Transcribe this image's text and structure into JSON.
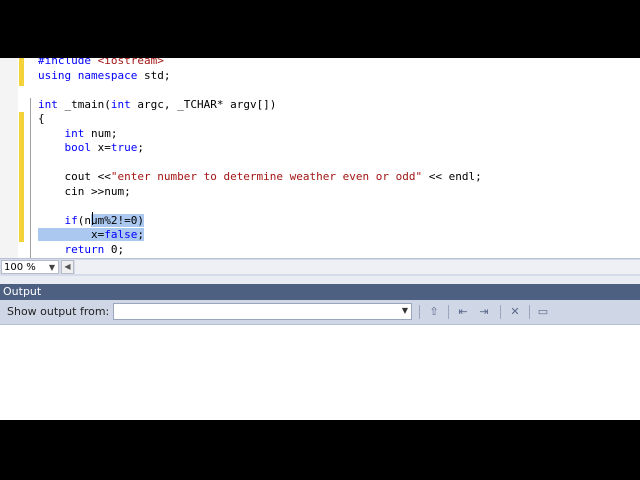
{
  "editor": {
    "lines": [
      {
        "parts": [
          {
            "t": "#include ",
            "c": "kw"
          },
          {
            "t": "<iostream>",
            "c": "str"
          }
        ]
      },
      {
        "parts": [
          {
            "t": "using namespace ",
            "c": "kw"
          },
          {
            "t": "std;",
            "c": ""
          }
        ]
      },
      {
        "parts": [
          {
            "t": "",
            "c": ""
          }
        ]
      },
      {
        "parts": [
          {
            "t": "int",
            "c": "kw"
          },
          {
            "t": " _tmain(",
            "c": ""
          },
          {
            "t": "int",
            "c": "kw"
          },
          {
            "t": " argc, _TCHAR* argv[])",
            "c": ""
          }
        ]
      },
      {
        "parts": [
          {
            "t": "{",
            "c": ""
          }
        ]
      },
      {
        "parts": [
          {
            "t": "    ",
            "c": ""
          },
          {
            "t": "int",
            "c": "kw"
          },
          {
            "t": " num;",
            "c": ""
          }
        ]
      },
      {
        "parts": [
          {
            "t": "    ",
            "c": ""
          },
          {
            "t": "bool",
            "c": "kw"
          },
          {
            "t": " x=",
            "c": ""
          },
          {
            "t": "true",
            "c": "kw"
          },
          {
            "t": ";",
            "c": ""
          }
        ]
      },
      {
        "parts": [
          {
            "t": "",
            "c": ""
          }
        ]
      },
      {
        "parts": [
          {
            "t": "    cout <<",
            "c": ""
          },
          {
            "t": "\"enter number to determine weather even or odd\"",
            "c": "str"
          },
          {
            "t": " << endl;",
            "c": ""
          }
        ]
      },
      {
        "parts": [
          {
            "t": "    cin >>num;",
            "c": ""
          }
        ]
      },
      {
        "parts": [
          {
            "t": "",
            "c": ""
          }
        ]
      },
      {
        "parts": [
          {
            "t": "    ",
            "c": ""
          },
          {
            "t": "if",
            "c": "kw"
          },
          {
            "t": "(n",
            "c": ""
          },
          {
            "t": "um%2!=0)",
            "c": "",
            "sel": true
          }
        ]
      },
      {
        "parts": [
          {
            "t": "        x=",
            "c": "",
            "sel": true
          },
          {
            "t": "false",
            "c": "kw",
            "sel": true
          },
          {
            "t": ";",
            "c": "",
            "sel": true
          }
        ]
      },
      {
        "parts": [
          {
            "t": "    ",
            "c": ""
          },
          {
            "t": "return",
            "c": "kw"
          },
          {
            "t": " 0;",
            "c": ""
          }
        ]
      }
    ]
  },
  "status": {
    "zoom": "100 %"
  },
  "output": {
    "title": "Output",
    "show_from_label": "Show output from:",
    "selected_source": ""
  },
  "colors": {
    "keyword": "#0000ff",
    "string": "#a31515",
    "selection": "#aac8f0",
    "change_bar": "#f4d23a",
    "output_header": "#4d6082"
  }
}
